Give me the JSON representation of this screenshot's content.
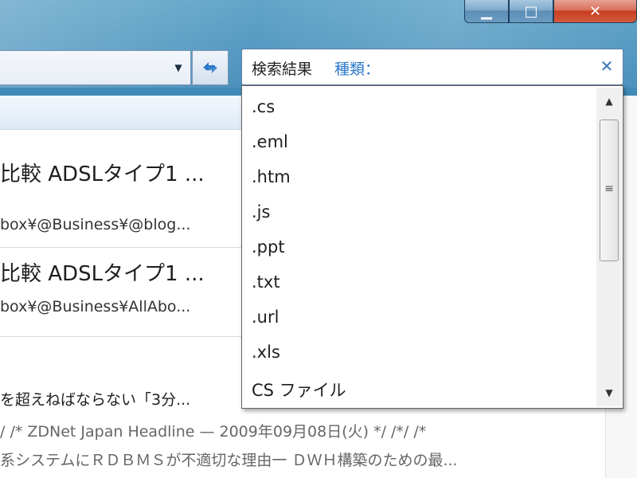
{
  "search": {
    "label": "検索結果",
    "filter_keyword": "種類：",
    "clear_icon": "close-icon",
    "options": [
      ".cs",
      ".eml",
      ".htm",
      ".js",
      ".ppt",
      ".txt",
      ".url",
      ".xls",
      "CS ファイル"
    ]
  },
  "window_controls": {
    "minimize_glyph": "▁",
    "maximize_glyph": "□",
    "close_glyph": "✕"
  },
  "results": [
    {
      "title": "比較 ADSLタイプ1 ...",
      "path": "box¥@Business¥@blog..."
    },
    {
      "title": "比較 ADSLタイプ1 ...",
      "path": "box¥@Business¥AllAbo..."
    }
  ],
  "extra_lines": [
    "を超えねばならない「3分...",
    "/ /* ZDNet Japan Headline — 2009年09月08日(火) */ /*/ /*",
    "系システムにＲＤＢＭＳが不適切な理由一 ＤＷＨ構築のための最..."
  ],
  "colors": {
    "accent": "#2c79c9",
    "frame": "#3f89b7",
    "close_button": "#c73e22"
  }
}
